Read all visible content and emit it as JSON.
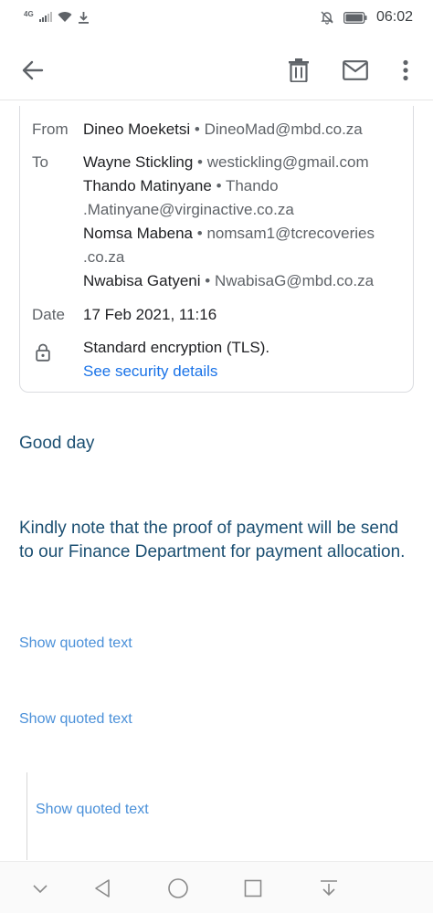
{
  "status_bar": {
    "network": "4G",
    "time": "06:02"
  },
  "toolbar": {
    "back_icon": "arrow-back-icon",
    "delete_icon": "trash-icon",
    "mark_unread_icon": "mail-icon",
    "more_icon": "more-vert-icon"
  },
  "details": {
    "from_label": "From",
    "from_name": "Dineo Moeketsi",
    "from_email": "DineoMad@mbd.co.za",
    "to_label": "To",
    "recipients": [
      {
        "name": "Wayne Stickling",
        "email": "westickling@gmail.com"
      },
      {
        "name": "Thando Matinyane",
        "email_line1": "Thando",
        "email_line2": ".Matinyane@virginactive.co.za"
      },
      {
        "name": "Nomsa Mabena",
        "email_line1": "nomsam1@tcrecoveries",
        "email_line2": ".co.za"
      },
      {
        "name": "Nwabisa Gatyeni",
        "email": "NwabisaG@mbd.co.za"
      }
    ],
    "separator": "•",
    "date_label": "Date",
    "date_value": "17 Feb 2021, 11:16",
    "encryption_text": "Standard encryption (TLS).",
    "security_link": "See security details"
  },
  "body": {
    "greeting": "Good day",
    "message": "Kindly note that the proof of payment will be send to our Finance Department for payment allocation.",
    "show_quoted_1": "Show quoted text",
    "show_quoted_2": "Show quoted text",
    "show_quoted_3": "Show quoted text"
  },
  "colors": {
    "body_text": "#1b4f72",
    "link": "#1a73e8",
    "quoted_link": "#4a90d9"
  }
}
